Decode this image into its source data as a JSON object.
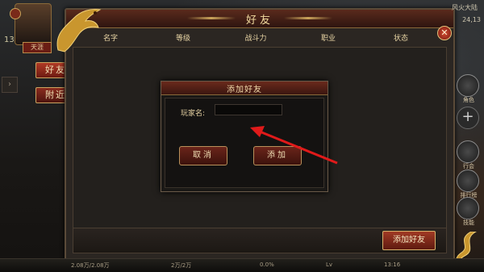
{
  "hud": {
    "level": "13",
    "player_tag": "天涯",
    "map_name": "风火大陆",
    "map_coords": "24,13",
    "right_icons": [
      {
        "label": "角色",
        "icon": "character-icon"
      },
      {
        "label": "",
        "icon": "plus-icon"
      },
      {
        "label": "行会",
        "icon": "guild-icon"
      },
      {
        "label": "排行榜",
        "icon": "leaderboard-icon"
      },
      {
        "label": "技能",
        "icon": "skill-icon"
      }
    ]
  },
  "side_tabs": {
    "friends": "好友",
    "nearby": "附近"
  },
  "panel": {
    "title": "好友",
    "columns": [
      "名字",
      "等级",
      "战斗力",
      "职业",
      "状态"
    ],
    "add_friend_label": "添加好友",
    "close_icon": "close-icon"
  },
  "dialog": {
    "title": "添加好友",
    "name_label": "玩家名:",
    "name_value": "",
    "cancel_label": "取消",
    "add_label": "添加"
  },
  "status_bar": {
    "hp": "2.08万/2.08万",
    "mp": "2万/2万",
    "exp": "0.0%",
    "lv": "Lv",
    "time": "13:16"
  },
  "colors": {
    "accent_red": "#a03a24",
    "gold": "#d6b06a",
    "annotation_arrow": "#e01a1a"
  }
}
